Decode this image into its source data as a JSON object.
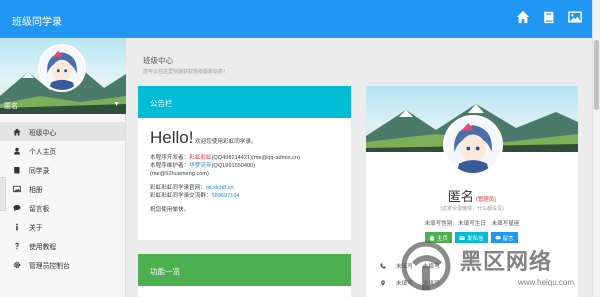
{
  "topbar": {
    "brand": "班级同学录",
    "icons": [
      "home-icon",
      "book-icon",
      "image-icon"
    ],
    "color": "#2196f3"
  },
  "sidebar": {
    "user_name": "匿名",
    "caret": "▼",
    "items": [
      {
        "label": "班级中心",
        "icon": "home-icon",
        "active": true
      },
      {
        "label": "个人主页",
        "icon": "user-icon",
        "active": false
      },
      {
        "label": "同学录",
        "icon": "book-icon",
        "active": false
      },
      {
        "label": "相册",
        "icon": "image-icon",
        "active": false
      },
      {
        "label": "留言板",
        "icon": "comment-icon",
        "active": false
      },
      {
        "label": "关于",
        "icon": "info-icon",
        "active": false
      },
      {
        "label": "使用教程",
        "icon": "question-icon",
        "active": false
      },
      {
        "label": "管理员控制台",
        "icon": "gear-icon",
        "active": false
      }
    ]
  },
  "main": {
    "breadcrumb": "班级中心",
    "breadcrumb_sub": "您可以在这里快速获取班级最新动态！",
    "notice": {
      "title": "公告栏",
      "color": "#00bcd4",
      "hello": "Hello!",
      "hello_sub": "欢迎您使用彩虹同学录。",
      "dev_prefix": "本程序开发者：",
      "dev_name": "彩虹彩虹",
      "dev_contact": "(QQ408214421)(me@qq-admin.cn)",
      "maint_prefix": "本程序维护者：",
      "maint_name": "华梦流年",
      "maint_contact": "(QQ1991550400)",
      "maint_email": "(me@52huameng.com)",
      "site_prefix": "彩虹彩虹同学录官网：",
      "site_value": "txl.xlch8.cn",
      "group_prefix": "彩虹彩虹同学录交流群：",
      "group_value": "589697104",
      "wish": "祝您使用愉快。"
    },
    "functions": {
      "title": "功能一览",
      "color": "#4caf50"
    }
  },
  "profile": {
    "name": "匿名",
    "role_tag": "(管理员)",
    "signature": "(这家伙很懒惰，什么都没写)",
    "info": [
      "未填写性别",
      "未填写生日",
      "未填写星座"
    ],
    "buttons": [
      {
        "label": "主页",
        "icon": "home-icon"
      },
      {
        "label": "发私信",
        "icon": "mail-icon"
      },
      {
        "label": "留言",
        "icon": "comment-icon"
      }
    ],
    "row1": [
      "未填写",
      "未填写"
    ],
    "row2": [
      "未填写",
      "未填写"
    ]
  },
  "watermark": {
    "text": "黑区网络",
    "url": "www.heiqu.com"
  }
}
